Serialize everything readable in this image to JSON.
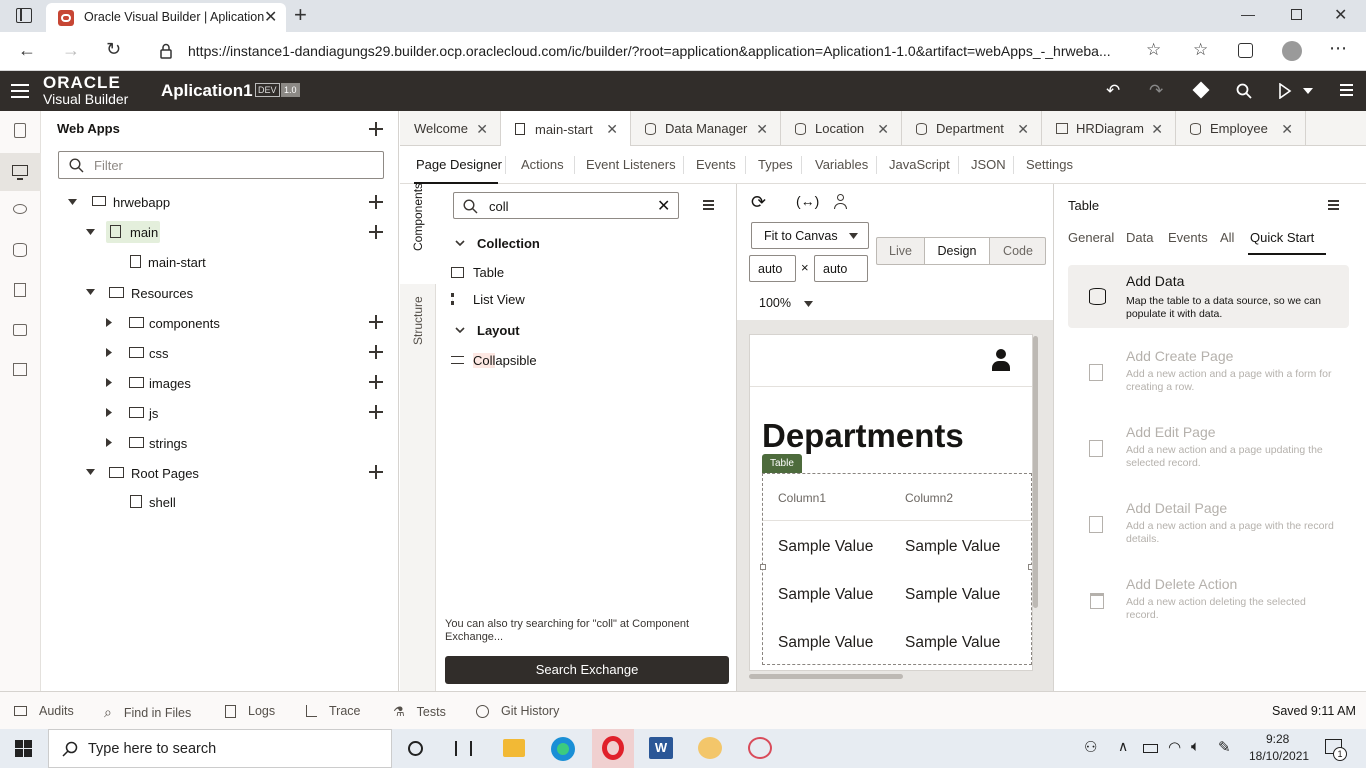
{
  "browser": {
    "tab_title": "Oracle Visual Builder | Aplication",
    "url": "https://instance1-dandiagungs29.builder.ocp.oraclecloud.com/ic/builder/?root=application&application=Aplication1-1.0&artifact=webApps_-_hrweba..."
  },
  "header": {
    "logo_line1": "ORACLE",
    "logo_line2": "Visual Builder",
    "app_name": "Aplication1",
    "badge_env": "DEV",
    "badge_version": "1.0"
  },
  "nav": {
    "title": "Web Apps",
    "filter_placeholder": "Filter",
    "tree": [
      {
        "label": "hrwebapp"
      },
      {
        "label": "main"
      },
      {
        "label": "main-start"
      },
      {
        "label": "Resources"
      },
      {
        "label": "components"
      },
      {
        "label": "css"
      },
      {
        "label": "images"
      },
      {
        "label": "js"
      },
      {
        "label": "strings"
      },
      {
        "label": "Root Pages"
      },
      {
        "label": "shell"
      }
    ]
  },
  "editor_tabs": [
    {
      "label": "Welcome"
    },
    {
      "label": "main-start"
    },
    {
      "label": "Data Manager"
    },
    {
      "label": "Location"
    },
    {
      "label": "Department"
    },
    {
      "label": "HRDiagram"
    },
    {
      "label": "Employee"
    }
  ],
  "designer_tabs": [
    {
      "label": "Page Designer"
    },
    {
      "label": "Actions"
    },
    {
      "label": "Event Listeners"
    },
    {
      "label": "Events"
    },
    {
      "label": "Types"
    },
    {
      "label": "Variables"
    },
    {
      "label": "JavaScript"
    },
    {
      "label": "JSON"
    },
    {
      "label": "Settings"
    }
  ],
  "palette": {
    "vtab_components": "Components",
    "vtab_structure": "Structure",
    "search_value": "coll",
    "section_collection": "Collection",
    "item_table": "Table",
    "item_listview": "List View",
    "section_layout": "Layout",
    "item_collapsible_hl": "Coll",
    "item_collapsible_rest": "apsible",
    "hint": "You can also try searching for \"coll\" at Component Exchange...",
    "search_exchange": "Search Exchange"
  },
  "canvas": {
    "fit": "Fit to Canvas",
    "mode_live": "Live",
    "mode_design": "Design",
    "mode_code": "Code",
    "width": "auto",
    "height": "auto",
    "times": "×",
    "zoom": "100%",
    "page_title": "Departments",
    "table_tag": "Table",
    "columns": [
      "Column1",
      "Column2"
    ],
    "rows": [
      [
        "Sample Value",
        "Sample Value"
      ],
      [
        "Sample Value",
        "Sample Value"
      ],
      [
        "Sample Value",
        "Sample Value"
      ]
    ]
  },
  "props": {
    "title": "Table",
    "tabs": [
      "General",
      "Data",
      "Events",
      "All",
      "Quick Start"
    ],
    "items": [
      {
        "title": "Add Data",
        "desc": "Map the table to a data source, so we can populate it with data."
      },
      {
        "title": "Add Create Page",
        "desc": "Add a new action and a page with a form for creating a row."
      },
      {
        "title": "Add Edit Page",
        "desc": "Add a new action and a page updating the selected record."
      },
      {
        "title": "Add Detail Page",
        "desc": "Add a new action and a page with the record details."
      },
      {
        "title": "Add Delete Action",
        "desc": "Add a new action deleting the selected record."
      }
    ]
  },
  "footer": {
    "items": [
      "Audits",
      "Find in Files",
      "Logs",
      "Trace",
      "Tests",
      "Git History"
    ],
    "status": "Saved 9:11 AM"
  },
  "taskbar": {
    "search_placeholder": "Type here to search",
    "time": "9:28",
    "date": "18/10/2021",
    "notif_count": "1"
  },
  "colors": {
    "header_bg": "#312d2a",
    "table_tag": "#4d6b3c",
    "search_exchange_bg": "#312d2a",
    "selected_tree": "#e4efdc"
  }
}
